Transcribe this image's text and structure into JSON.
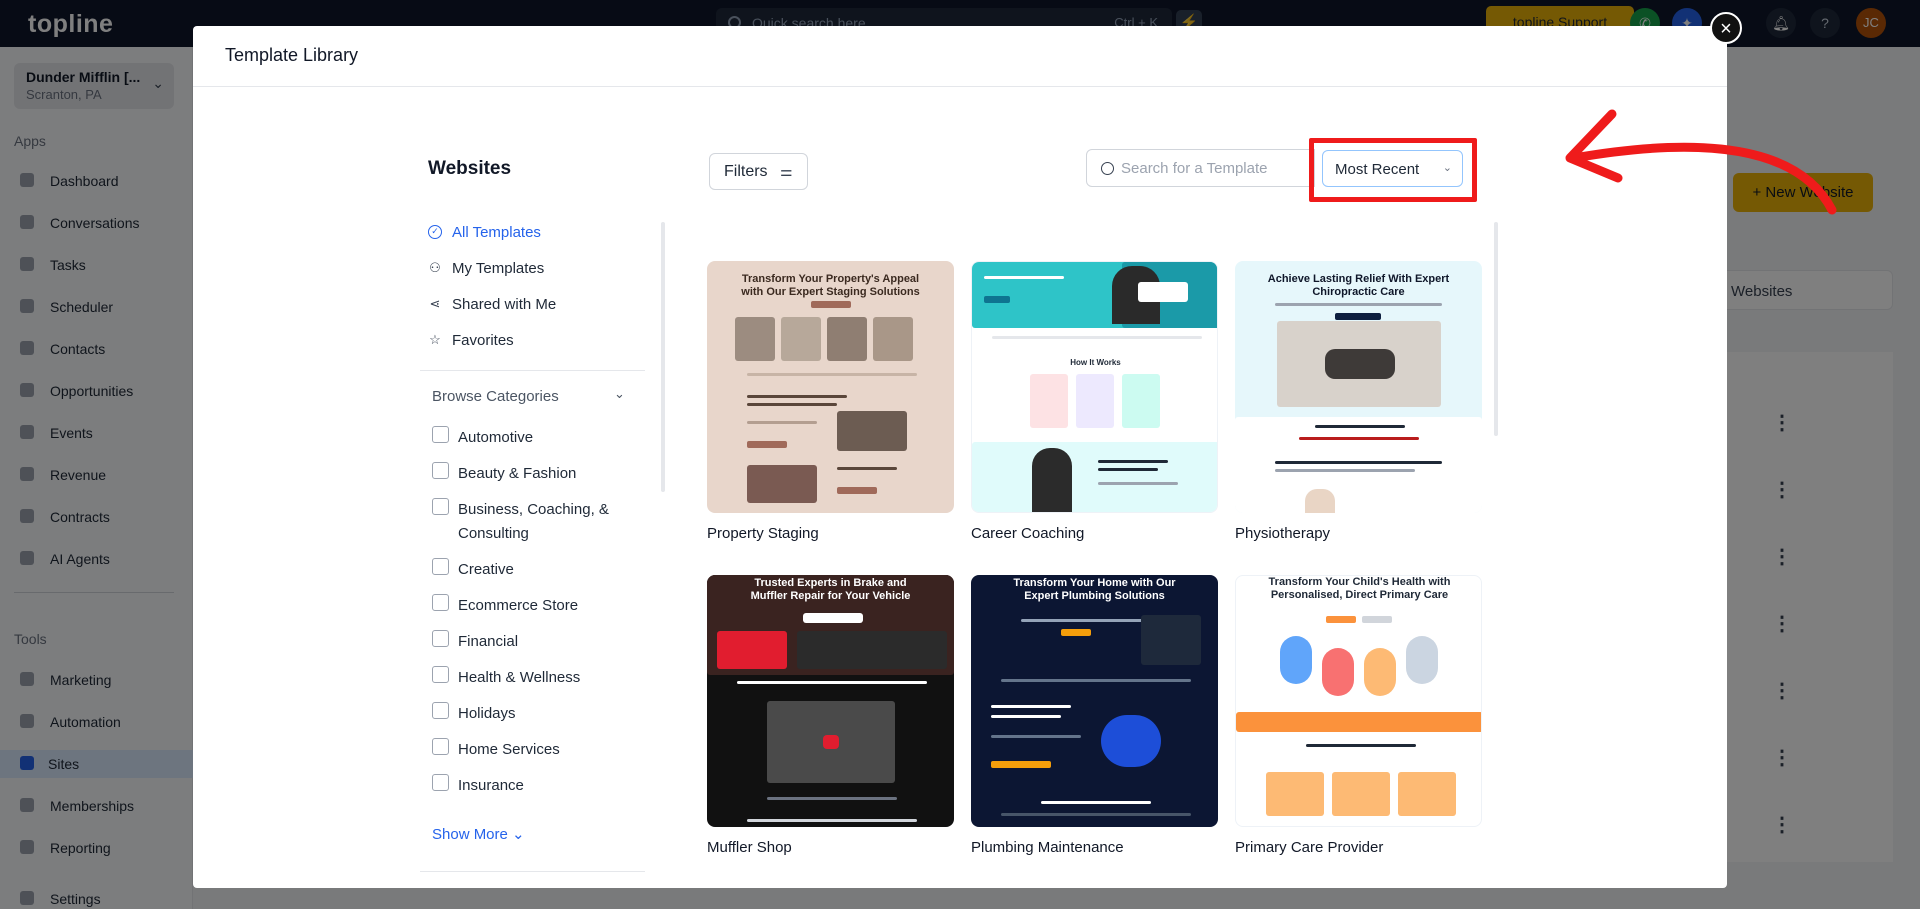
{
  "topbar": {
    "logo": "topline",
    "quick_search_placeholder": "Quick search here",
    "quick_search_shortcut": "Ctrl + K",
    "support_label": "topline Support",
    "avatar_initials": "JC"
  },
  "sidebar": {
    "account_name": "Dunder Mifflin [...",
    "account_location": "Scranton, PA",
    "apps_heading": "Apps",
    "tools_heading": "Tools",
    "apps": [
      {
        "label": "Dashboard"
      },
      {
        "label": "Conversations"
      },
      {
        "label": "Tasks"
      },
      {
        "label": "Scheduler"
      },
      {
        "label": "Contacts"
      },
      {
        "label": "Opportunities"
      },
      {
        "label": "Events"
      },
      {
        "label": "Revenue"
      },
      {
        "label": "Contracts"
      },
      {
        "label": "AI Agents"
      }
    ],
    "tools": [
      {
        "label": "Marketing"
      },
      {
        "label": "Automation"
      },
      {
        "label": "Sites"
      },
      {
        "label": "Memberships"
      },
      {
        "label": "Reporting"
      }
    ],
    "settings_label": "Settings"
  },
  "background": {
    "new_website_label": "New Website",
    "websites_tab": "Websites"
  },
  "modal": {
    "title": "Template Library",
    "left_title": "Websites",
    "library_links": [
      {
        "label": "All Templates"
      },
      {
        "label": "My Templates"
      },
      {
        "label": "Shared with Me"
      },
      {
        "label": "Favorites"
      }
    ],
    "browse_title": "Browse Categories",
    "categories": [
      {
        "label": "Automotive"
      },
      {
        "label": "Beauty & Fashion"
      },
      {
        "label": "Business, Coaching, & Consulting"
      },
      {
        "label": "Creative"
      },
      {
        "label": "Ecommerce Store"
      },
      {
        "label": "Financial"
      },
      {
        "label": "Health & Wellness"
      },
      {
        "label": "Holidays"
      },
      {
        "label": "Home Services"
      },
      {
        "label": "Insurance"
      }
    ],
    "show_more": "Show More",
    "filters_label": "Filters",
    "search_placeholder": "Search for a Template",
    "sort_value": "Most Recent",
    "templates": [
      {
        "name": "Property Staging",
        "headline": "Transform Your Property's Appeal with Our Expert Staging Solutions"
      },
      {
        "name": "Career Coaching",
        "headline": "How It Works"
      },
      {
        "name": "Physiotherapy",
        "headline": "Achieve Lasting Relief With Expert Chiropractic Care"
      },
      {
        "name": "Muffler Shop",
        "headline": "Trusted Experts in Brake and Muffler Repair for Your Vehicle"
      },
      {
        "name": "Plumbing Maintenance",
        "headline": "Transform Your Home with Our Expert Plumbing Solutions"
      },
      {
        "name": "Primary Care Provider",
        "headline": "Transform Your Child's Health with Personalised, Direct Primary Care"
      }
    ]
  },
  "colors": {
    "topbar": "#0f172a",
    "accent": "#2563eb",
    "highlight": "#ef1b1b",
    "support": "#eab308"
  }
}
